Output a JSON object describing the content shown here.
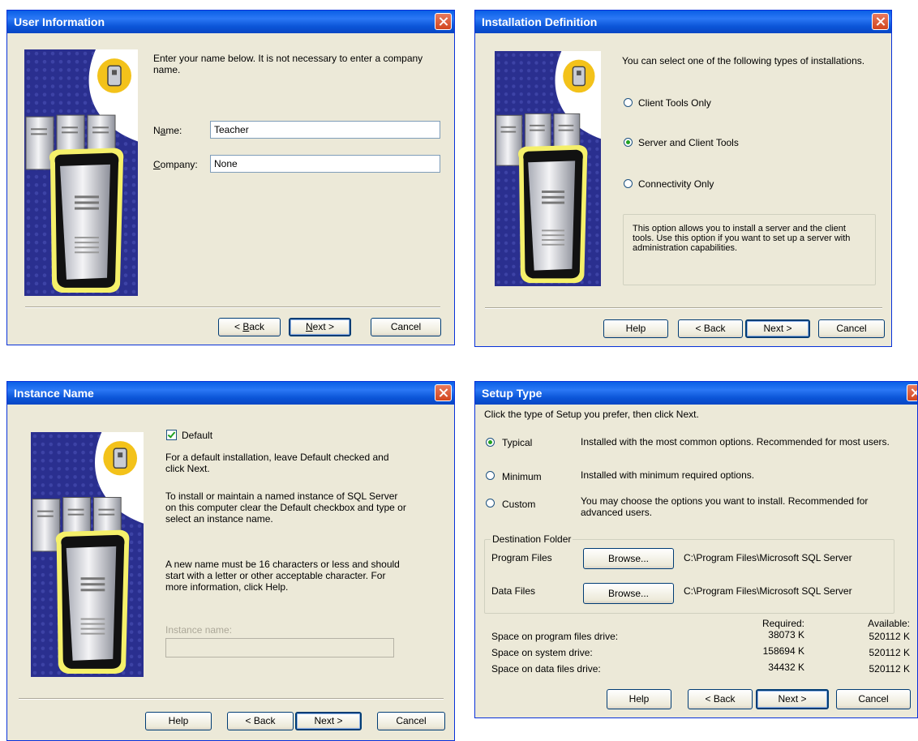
{
  "colors": {
    "title_bar": "#0a5fe6",
    "dialog_bg": "#ece9d8",
    "art_navy": "#2a2f8f",
    "art_badge": "#f3c21a"
  },
  "user_info": {
    "title": "User Information",
    "description": "Enter your name below.  It is not necessary to enter a company name.",
    "name_label": "Name:",
    "name_value": "Teacher",
    "company_label": "Company:",
    "company_value": "None",
    "back": "< Back",
    "next": "Next >",
    "cancel": "Cancel"
  },
  "install_def": {
    "title": "Installation Definition",
    "intro": "You can select one of the following types of installations.",
    "options": [
      "Client Tools Only",
      "Server and Client Tools",
      "Connectivity Only"
    ],
    "selected": "Server and Client Tools",
    "description": "This option allows you to install a server and the client tools. Use this option if you want to set up a server with administration capabilities.",
    "help": "Help",
    "back": "< Back",
    "next": "Next >",
    "cancel": "Cancel"
  },
  "instance": {
    "title": "Instance Name",
    "default_label": "Default",
    "default_checked": true,
    "para1": "For a default installation, leave Default checked and click Next.",
    "para2": "To install or maintain a named instance of SQL Server on this computer clear the Default checkbox and type or select an instance name.",
    "para3": "A new name must be 16 characters or less and should start with a letter or other acceptable character.  For more information, click Help.",
    "instance_name_label": "Instance name:",
    "instance_name_value": "",
    "help": "Help",
    "back": "< Back",
    "next": "Next >",
    "cancel": "Cancel"
  },
  "setup_type": {
    "title": "Setup Type",
    "intro": "Click the type of Setup you prefer, then click Next.",
    "options": [
      {
        "label": "Typical",
        "desc": "Installed with the most common options. Recommended for most users.",
        "selected": true
      },
      {
        "label": "Minimum",
        "desc": "Installed with minimum required options.",
        "selected": false
      },
      {
        "label": "Custom",
        "desc": "You may choose the options you want to install. Recommended for advanced users.",
        "selected": false
      }
    ],
    "destination_label": "Destination Folder",
    "program_files_label": "Program Files",
    "program_files_path": "C:\\Program Files\\Microsoft SQL Server",
    "data_files_label": "Data Files",
    "data_files_path": "C:\\Program Files\\Microsoft SQL Server",
    "browse": "Browse...",
    "required_header": "Required:",
    "available_header": "Available:",
    "space_rows": [
      {
        "label": "Space on program files drive:",
        "required": "38073 K",
        "available": "520112 K"
      },
      {
        "label": "Space on system drive:",
        "required": "158694 K",
        "available": "520112 K"
      },
      {
        "label": "Space on data files drive:",
        "required": "34432 K",
        "available": "520112 K"
      }
    ],
    "help": "Help",
    "back": "< Back",
    "next": "Next >",
    "cancel": "Cancel"
  }
}
